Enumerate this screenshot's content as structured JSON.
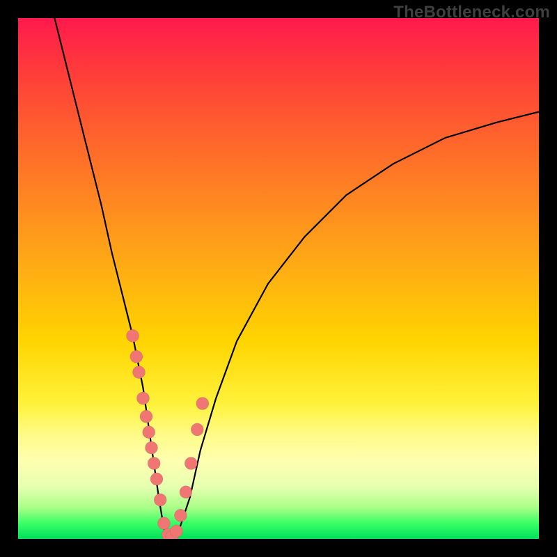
{
  "watermark": "TheBottleneck.com",
  "palette": {
    "gradient_top": "#ff1a4d",
    "gradient_mid": "#ffd400",
    "gradient_bottom": "#00e05a",
    "dot_color": "#ef7673",
    "curve_color": "#000000",
    "frame_border": "#000000"
  },
  "chart_data": {
    "type": "line",
    "title": "",
    "xlabel": "",
    "ylabel": "",
    "xlim": [
      0,
      100
    ],
    "ylim": [
      0,
      100
    ],
    "series": [
      {
        "name": "bottleneck-curve",
        "x": [
          7,
          10,
          13,
          16,
          18,
          20,
          22,
          24,
          25,
          26,
          27,
          28,
          29,
          30,
          31,
          33,
          35,
          38,
          42,
          48,
          55,
          63,
          72,
          82,
          92,
          100
        ],
        "y": [
          100,
          88,
          76,
          64,
          55,
          47,
          39,
          29,
          22,
          15,
          8,
          2,
          0,
          0,
          2,
          8,
          17,
          27,
          38,
          49,
          58,
          66,
          72,
          77,
          80,
          82
        ]
      }
    ],
    "dots": {
      "name": "data-points",
      "comment": "Pink sample markers clustered along the lower part of the V",
      "x": [
        22.0,
        22.7,
        23.2,
        24.0,
        24.6,
        25.1,
        25.6,
        26.1,
        26.6,
        27.3,
        28.0,
        28.8,
        29.5,
        30.4,
        31.2,
        32.2,
        33.2,
        34.4,
        35.4
      ],
      "y": [
        39.0,
        35.0,
        32.0,
        27.0,
        23.5,
        20.5,
        17.5,
        14.5,
        11.5,
        7.5,
        3.0,
        0.8,
        0.4,
        1.5,
        4.5,
        9.0,
        14.5,
        21.0,
        26.0
      ]
    }
  }
}
